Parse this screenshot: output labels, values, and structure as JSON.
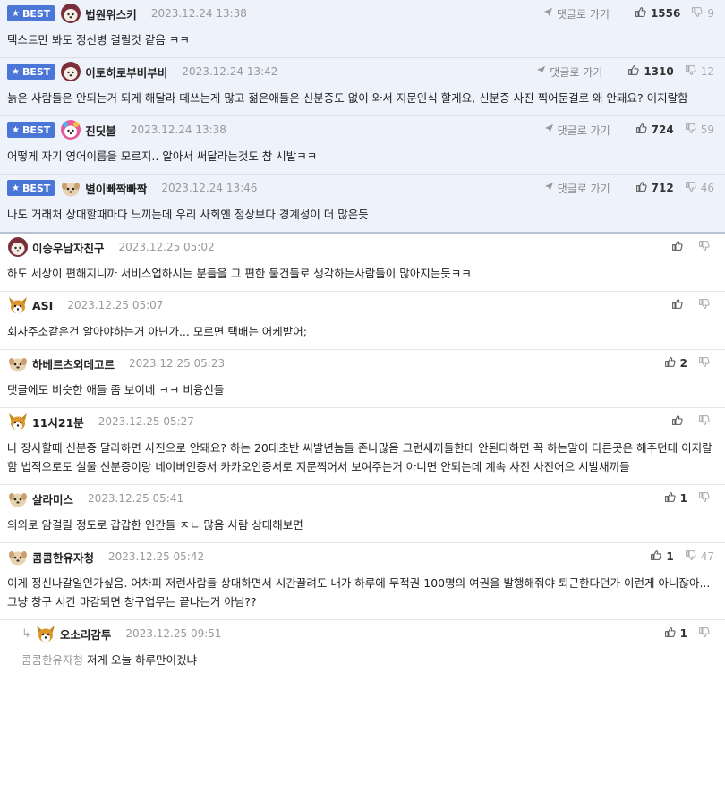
{
  "labels": {
    "best": "BEST",
    "reply": "댓글로 가기"
  },
  "colors": {
    "best_bg": "#eef2fb",
    "badge": "#4a76d8"
  },
  "comments": [
    {
      "best": true,
      "avatar": "fox-hat-avatar-icon",
      "nick": "법원위스키",
      "date": "2023.12.24 13:38",
      "show_reply": true,
      "up": "1556",
      "down": "9",
      "text": "텍스트만 봐도 정신병 걸릴것 같음 ㅋㅋ"
    },
    {
      "best": true,
      "avatar": "fox-hat-avatar-icon",
      "nick": "이토히로부비부비",
      "date": "2023.12.24 13:42",
      "show_reply": true,
      "up": "1310",
      "down": "12",
      "text": "늙은 사람들은 안되는거 되게 해달라 떼쓰는게 많고 젊은애들은 신분증도 없이 와서 지문인식 할게요, 신분증 사진 찍어둔걸로 왜 안돼요? 이지랄함"
    },
    {
      "best": true,
      "avatar": "fox-colorful-avatar-icon",
      "nick": "진딧불",
      "date": "2023.12.24 13:38",
      "show_reply": true,
      "up": "724",
      "down": "59",
      "text": "어떻게 자기 영어이름을 모르지.. 알아서 써달라는것도 참 시발ㅋㅋ"
    },
    {
      "best": true,
      "avatar": "dog-avatar-icon",
      "nick": "별이빠짝빠짝",
      "date": "2023.12.24 13:46",
      "show_reply": true,
      "up": "712",
      "down": "46",
      "text": "나도 거래처 상대할때마다 느끼는데 우리 사회엔 정상보다 경계성이 더 많은듯"
    },
    {
      "best": false,
      "avatar": "fox-hat-avatar-icon",
      "nick": "이승우남자친구",
      "date": "2023.12.25 05:02",
      "show_reply": false,
      "up": "",
      "down": "",
      "text": "하도 세상이 편해지니까 서비스업하시는 분들을 그 편한 물건들로 생각하는사람들이 많아지는듯ㅋㅋ"
    },
    {
      "best": false,
      "avatar": "fox-avatar-icon",
      "nick": "ASI",
      "date": "2023.12.25 05:07",
      "show_reply": false,
      "up": "",
      "down": "",
      "text": "회사주소같은건 알아야하는거 아닌가... 모르면 택배는 어케받어;"
    },
    {
      "best": false,
      "avatar": "dog-avatar-icon",
      "nick": "하베르츠외데고르",
      "date": "2023.12.25 05:23",
      "show_reply": false,
      "up": "2",
      "down": "",
      "text": "댓글에도 비슷한 애들 좀 보이네 ㅋㅋ 비융신들"
    },
    {
      "best": false,
      "avatar": "fox-avatar-icon",
      "nick": "11시21분",
      "date": "2023.12.25 05:27",
      "show_reply": false,
      "up": "",
      "down": "",
      "text": "나 장사할때 신분증 달라하면 사진으로 안돼요? 하는 20대초반 씨발년놈들 존나많음 그런새끼들한테 안된다하면 꼭 하는말이 다른곳은 해주던데 이지랄함 법적으로도 실물 신분증이랑 네이버인증서 카카오인증서로 지문찍어서 보여주는거 아니면 안되는데 계속 사진 사진어으 시발새끼들"
    },
    {
      "best": false,
      "avatar": "dog-avatar-icon",
      "nick": "살라미스",
      "date": "2023.12.25 05:41",
      "show_reply": false,
      "up": "1",
      "down": "",
      "text": "의외로 암걸릴 정도로 갑갑한 인간들 ㅈㄴ 많음 사람 상대해보면"
    },
    {
      "best": false,
      "avatar": "dog-avatar-icon",
      "nick": "콤콤한유자청",
      "date": "2023.12.25 05:42",
      "show_reply": false,
      "up": "1",
      "down": "47",
      "text": "이게 정신나갈일인가싶음. 어차피 저런사람들 상대하면서 시간끌려도 내가 하루에 무적권 100명의 여권을 발행해줘야 퇴근한다던가 이런게 아니잖아... 그냥 창구 시간 마감되면 창구업무는 끝나는거 아님??"
    }
  ],
  "reply_comment": {
    "avatar": "fox-avatar-icon",
    "nick": "오소리감투",
    "date": "2023.12.25 09:51",
    "up": "1",
    "down": "",
    "mention": "콤콤한유자청",
    "text": "저게 오늘 하루만이겠냐"
  }
}
